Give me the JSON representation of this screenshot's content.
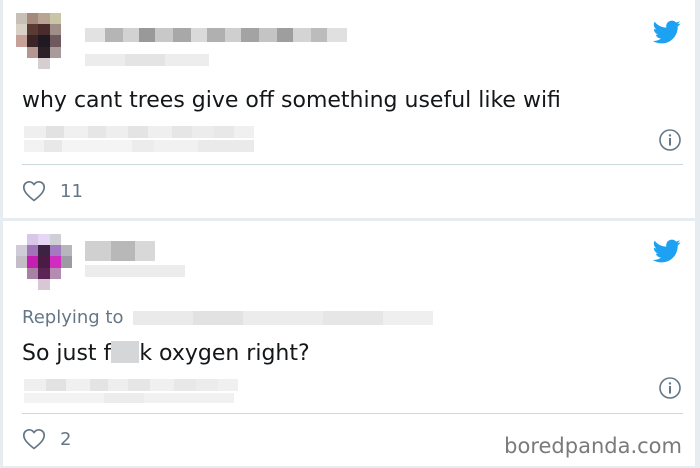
{
  "tweets": [
    {
      "text": "why cant trees give off something useful like wifi",
      "likes": "11"
    },
    {
      "replying_label": "Replying to",
      "text_before": "So just f",
      "text_after": "k oxygen right?",
      "likes": "2"
    }
  ],
  "watermark": "boredpanda.com",
  "colors": {
    "twitter_blue": "#1da1f2",
    "muted_text": "#657786",
    "divider": "#ccd6dd"
  },
  "icons": {
    "brand": "twitter-bird-icon",
    "info": "info-icon",
    "like": "heart-outline-icon"
  }
}
